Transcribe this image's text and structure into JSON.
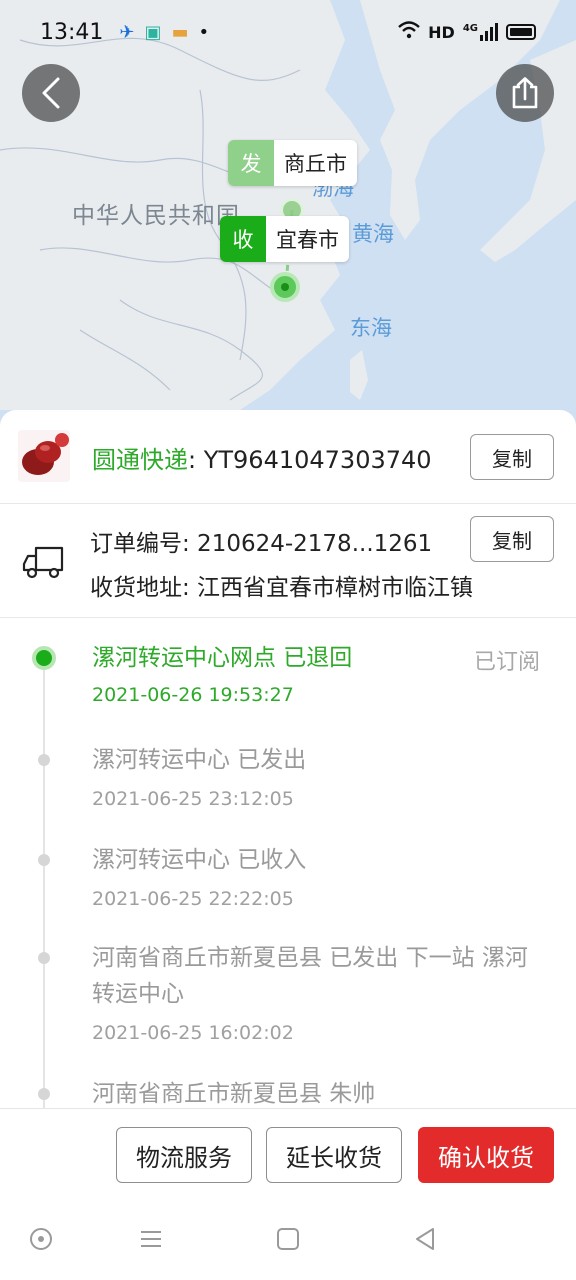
{
  "status_bar": {
    "time": "13:41",
    "network": "HD",
    "signal": "4G"
  },
  "map": {
    "country": "中华人民共和国",
    "seas": [
      "渤海",
      "黄海",
      "东海"
    ],
    "sender": {
      "tag": "发",
      "city": "商丘市"
    },
    "receiver": {
      "tag": "收",
      "city": "宜春市"
    }
  },
  "shipment": {
    "courier": "圆通快递",
    "tracking_number": ": YT9641047303740",
    "copy_label": "复制"
  },
  "order": {
    "number_line": "订单编号: 210624-2178...1261",
    "address_line": "收货地址: 江西省宜春市樟树市临江镇",
    "copy_label": "复制"
  },
  "timeline": {
    "subscribed_label": "已订阅",
    "events": [
      {
        "title": "漯河转运中心网点 已退回",
        "time": "2021-06-26 19:53:27"
      },
      {
        "title": "漯河转运中心 已发出",
        "time": "2021-06-25 23:12:05"
      },
      {
        "title": "漯河转运中心 已收入",
        "time": "2021-06-25 22:22:05"
      },
      {
        "title": "河南省商丘市新夏邑县 已发出 下一站 漯河转运中心",
        "time": "2021-06-25 16:02:02"
      },
      {
        "title": "河南省商丘市新夏邑县 朱帅",
        "time": ""
      }
    ]
  },
  "actions": {
    "logistics_service": "物流服务",
    "extend_receipt": "延长收货",
    "confirm_receipt": "确认收货"
  },
  "colors": {
    "accent_green": "#1aad19",
    "confirm_red": "#e32b2b"
  },
  "icons": {
    "back": "chevron-left-icon",
    "share": "share-icon",
    "truck": "truck-icon"
  }
}
